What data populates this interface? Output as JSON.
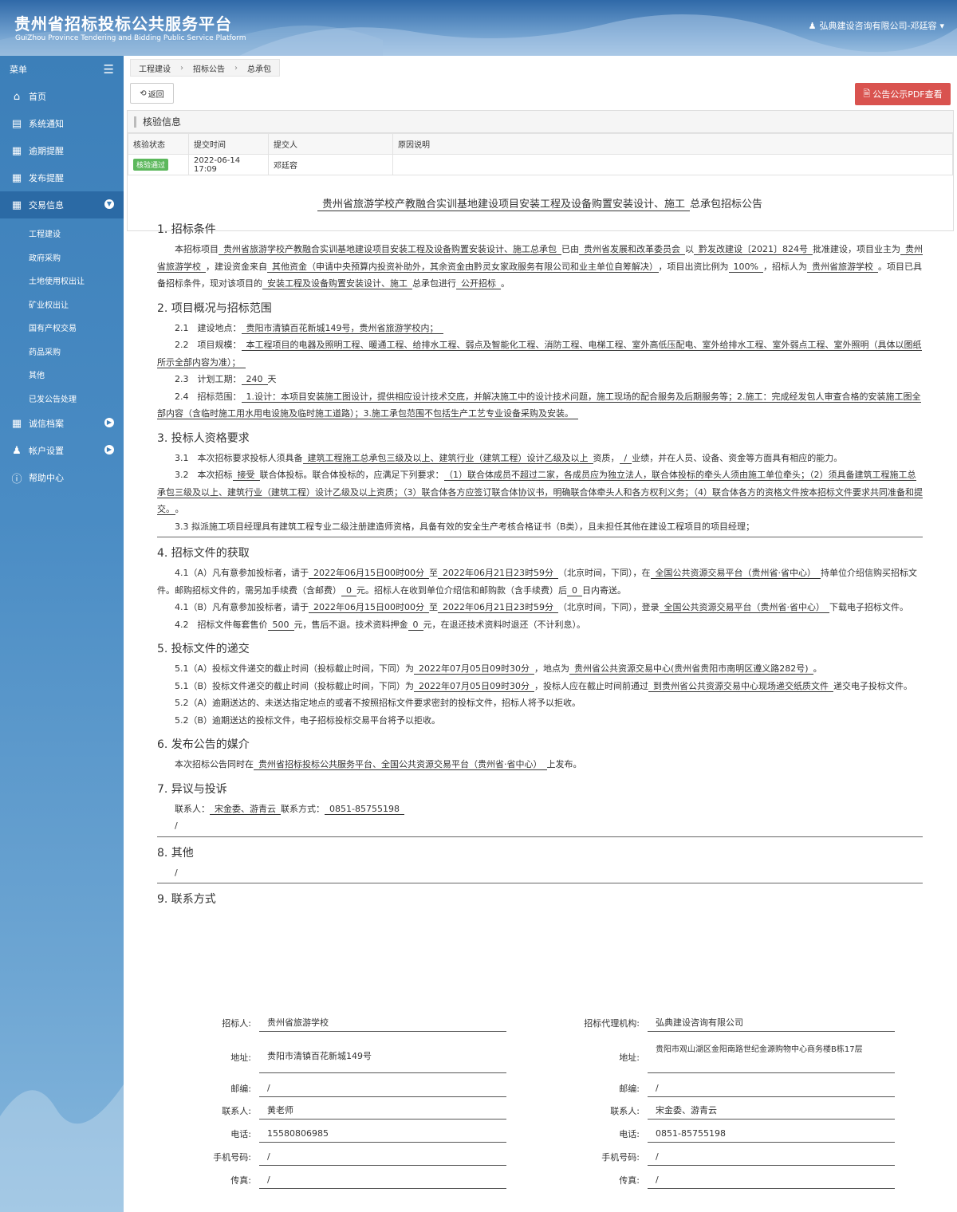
{
  "header": {
    "title": "贵州省招标投标公共服务平台",
    "subtitle": "GuiZhou Province Tendering and Bidding Public Service Platform",
    "user": "弘典建设咨询有限公司-邓廷容"
  },
  "sidebar": {
    "menu_label": "菜单",
    "items": [
      {
        "label": "首页",
        "icon": "home-icon"
      },
      {
        "label": "系统通知",
        "icon": "monitor-icon"
      },
      {
        "label": "逾期提醒",
        "icon": "newspaper-icon"
      },
      {
        "label": "发布提醒",
        "icon": "newspaper-icon"
      },
      {
        "label": "交易信息",
        "icon": "newspaper-icon"
      }
    ],
    "subitems": [
      "工程建设",
      "政府采购",
      "土地使用权出让",
      "矿业权出让",
      "国有产权交易",
      "药品采购",
      "其他",
      "已发公告处理"
    ],
    "items2": [
      {
        "label": "诚信档案",
        "icon": "newspaper-icon"
      },
      {
        "label": "帐户设置",
        "icon": "user-icon"
      },
      {
        "label": "帮助中心",
        "icon": "help-icon"
      }
    ]
  },
  "breadcrumb": [
    "工程建设",
    "招标公告",
    "总承包"
  ],
  "toolbar": {
    "back": "返回",
    "pdf": "公告公示PDF查看"
  },
  "verify": {
    "title": "核验信息",
    "headers": [
      "核验状态",
      "提交时间",
      "提交人",
      "原因说明"
    ],
    "status": "核验通过",
    "time": "2022-06-14 17:09",
    "person": "邓廷容",
    "reason": ""
  },
  "notice": {
    "title_main": "贵州省旅游学校产教融合实训基地建设项目安装工程及设备购置安装设计、施工",
    "title_tail": "总承包招标公告",
    "s1": "1. 招标条件",
    "s1_parts": [
      "本招标项目",
      "贵州省旅游学校产教融合实训基地建设项目安装工程及设备购置安装设计、施工总承包",
      "已由",
      "贵州省发展和改革委员会",
      "以",
      "黔发改建设〔2021〕824号",
      "批准建设，项目业主为",
      "贵州省旅游学校",
      "，建设资金来自",
      "其他资金（申请中央预算内投资补助外，其余资金由黔灵女家政服务有限公司和业主单位自筹解决）",
      "，项目出资比例为",
      "100%",
      "，招标人为",
      "贵州省旅游学校",
      "。项目已具备招标条件，现对该项目的",
      "安装工程及设备购置安装设计、施工",
      "总承包进行",
      "公开招标",
      "。"
    ],
    "s2": "2. 项目概况与招标范围",
    "s2_1": [
      "2.1　建设地点：",
      "贵阳市清镇百花新城149号，贵州省旅游学校内；"
    ],
    "s2_2": [
      "2.2　项目规模：",
      "本工程项目的电器及照明工程、暖通工程、给排水工程、弱点及智能化工程、消防工程、电梯工程、室外高低压配电、室外给排水工程、室外弱点工程、室外照明（具体以图纸所示全部内容为准）；"
    ],
    "s2_3": [
      "2.3　计划工期：",
      "240",
      "天"
    ],
    "s2_4": [
      "2.4　招标范围：",
      "1.设计：本项目安装施工图设计，提供相应设计技术交底，并解决施工中的设计技术问题，施工现场的配合服务及后期服务等；2.施工：完成经发包人审查合格的安装施工图全部内容（含临时施工用水用电设施及临时施工道路）；3.施工承包范围不包括生产工艺专业设备采购及安装。"
    ],
    "s3": "3. 投标人资格要求",
    "s3_1": [
      "3.1　本次招标要求投标人须具备",
      "建筑工程施工总承包三级及以上、建筑行业（建筑工程）设计乙级及以上",
      "资质，",
      "/",
      "业绩，并在人员、设备、资金等方面具有相应的能力。"
    ],
    "s3_2": [
      "3.2　本次招标",
      "接受",
      "联合体投标。联合体投标的，应满足下列要求：",
      "（1）联合体成员不超过二家，各成员应为独立法人，联合体投标的牵头人须由施工单位牵头；（2）须具备建筑工程施工总承包三级及以上、建筑行业（建筑工程）设计乙级及以上资质；（3）联合体各方应签订联合体协议书，明确联合体牵头人和各方权利义务；（4）联合体各方的资格文件按本招标文件要求共同准备和提交。",
      "。"
    ],
    "s3_3": "3.3 拟派施工项目经理具有建筑工程专业二级注册建造师资格，具备有效的安全生产考核合格证书（B类），且未担任其他在建设工程项目的项目经理；",
    "s4": "4. 招标文件的获取",
    "s4_1a": [
      "4.1（A）凡有意参加投标者，请于",
      "2022年06月15日00时00分",
      "至",
      "2022年06月21日23时59分",
      "（北京时间，下同），在",
      "全国公共资源交易平台（贵州省·省中心）",
      "持单位介绍信购买招标文件。邮购招标文件的，需另加手续费（含邮费）",
      "0",
      "元。招标人在收到单位介绍信和邮购款（含手续费）后",
      "0",
      "日内寄送。"
    ],
    "s4_1b": [
      "4.1（B）凡有意参加投标者，请于",
      "2022年06月15日00时00分",
      "至",
      "2022年06月21日23时59分",
      "（北京时间，下同），登录",
      "全国公共资源交易平台（贵州省·省中心）",
      "下载电子招标文件。"
    ],
    "s4_2": [
      "4.2　招标文件每套售价",
      "500",
      "元，售后不退。技术资料押金",
      "0",
      "元，在退还技术资料时退还（不计利息）。"
    ],
    "s5": "5. 投标文件的递交",
    "s5_1a": [
      "5.1（A）投标文件递交的截止时间（投标截止时间，下同）为",
      "2022年07月05日09时30分",
      "，地点为",
      "贵州省公共资源交易中心(贵州省贵阳市南明区遵义路282号)",
      "。"
    ],
    "s5_1b": [
      "5.1（B）投标文件递交的截止时间（投标截止时间，下同）为",
      "2022年07月05日09时30分",
      "，投标人应在截止时间前通过",
      "到贵州省公共资源交易中心现场递交纸质文件",
      "递交电子投标文件。"
    ],
    "s5_2a": "5.2（A）逾期送达的、未送达指定地点的或者不按照招标文件要求密封的投标文件，招标人将予以拒收。",
    "s5_2b": "5.2（B）逾期送达的投标文件，电子招标投标交易平台将予以拒收。",
    "s6": "6. 发布公告的媒介",
    "s6_p": [
      "本次招标公告同时在",
      "贵州省招标投标公共服务平台、全国公共资源交易平台（贵州省·省中心）",
      "上发布。"
    ],
    "s7": "7. 异议与投诉",
    "s7_p": [
      "联系人：",
      "宋金委、游青云",
      "联系方式：",
      "0851-85755198"
    ],
    "s7_slash": "/",
    "s8": "8. 其他",
    "s8_slash": "/",
    "s9": "9. 联系方式"
  },
  "contacts": {
    "left": [
      {
        "label": "招标人:",
        "value": "贵州省旅游学校"
      },
      {
        "label": "地址:",
        "value": "贵阳市清镇百花新城149号"
      },
      {
        "label": "邮编:",
        "value": "/"
      },
      {
        "label": "联系人:",
        "value": "黄老师"
      },
      {
        "label": "电话:",
        "value": "15580806985"
      },
      {
        "label": "手机号码:",
        "value": "/"
      },
      {
        "label": "传真:",
        "value": "/"
      }
    ],
    "right": [
      {
        "label": "招标代理机构:",
        "value": "弘典建设咨询有限公司"
      },
      {
        "label": "地址:",
        "value": "贵阳市观山湖区金阳南路世纪金源购物中心商务楼B栋17层"
      },
      {
        "label": "邮编:",
        "value": "/"
      },
      {
        "label": "联系人:",
        "value": "宋金委、游青云"
      },
      {
        "label": "电话:",
        "value": "0851-85755198"
      },
      {
        "label": "手机号码:",
        "value": "/"
      },
      {
        "label": "传真:",
        "value": "/"
      }
    ]
  }
}
